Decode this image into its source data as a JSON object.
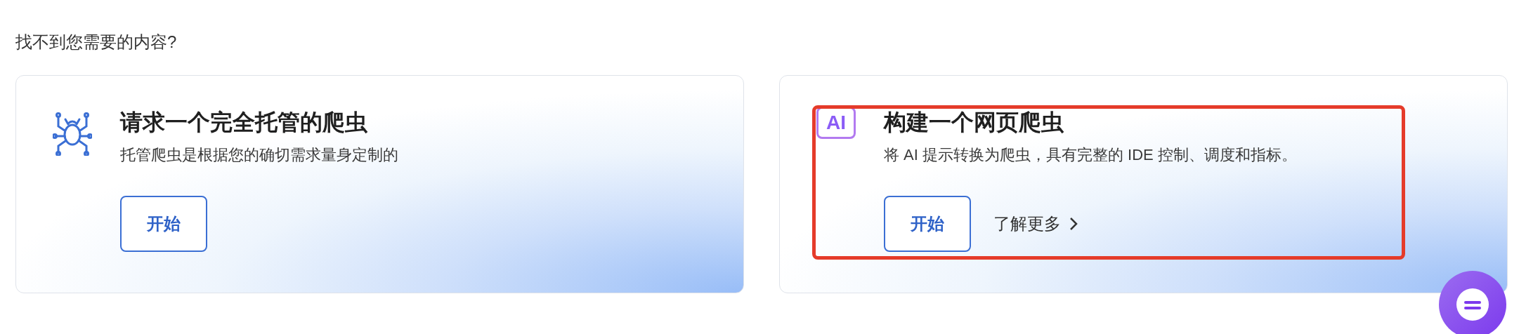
{
  "heading": "找不到您需要的内容?",
  "cards": [
    {
      "kind": "spider",
      "title": "请求一个完全托管的爬虫",
      "description": "托管爬虫是根据您的确切需求量身定制的",
      "start_button": "开始",
      "highlighted": false
    },
    {
      "kind": "ai",
      "icon_text": "AI",
      "title": "构建一个网页爬虫",
      "description": "将 AI 提示转换为爬虫，具有完整的 IDE 控制、调度和指标。",
      "start_button": "开始",
      "learn_more": "了解更多",
      "highlighted": true
    }
  ]
}
